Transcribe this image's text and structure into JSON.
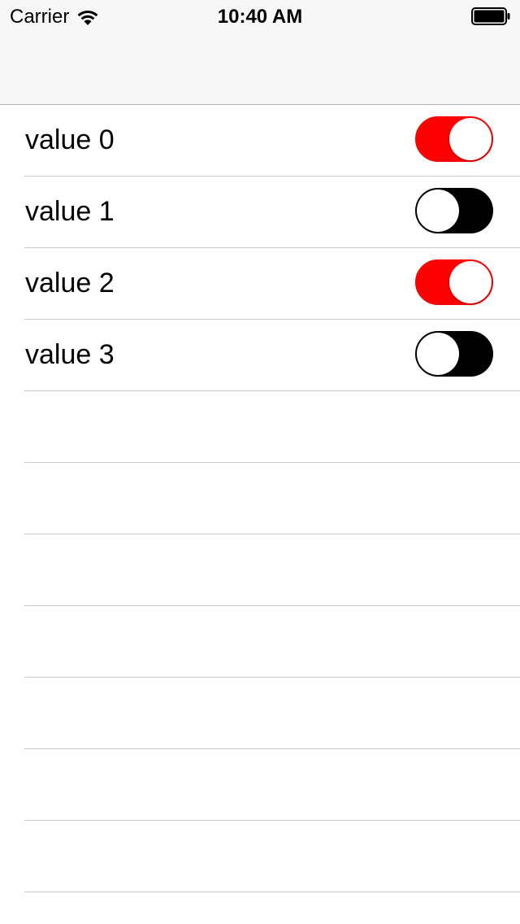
{
  "status_bar": {
    "carrier": "Carrier",
    "time": "10:40 AM",
    "wifi_icon": "wifi-icon",
    "battery_icon": "battery-full-icon"
  },
  "colors": {
    "switch_on": "#ff0000",
    "switch_off": "#000000",
    "separator": "#c8c7cc",
    "nav_background": "#f7f7f7"
  },
  "rows": [
    {
      "label": "value 0",
      "switch_on": true
    },
    {
      "label": "value 1",
      "switch_on": false
    },
    {
      "label": "value 2",
      "switch_on": true
    },
    {
      "label": "value 3",
      "switch_on": false
    }
  ]
}
